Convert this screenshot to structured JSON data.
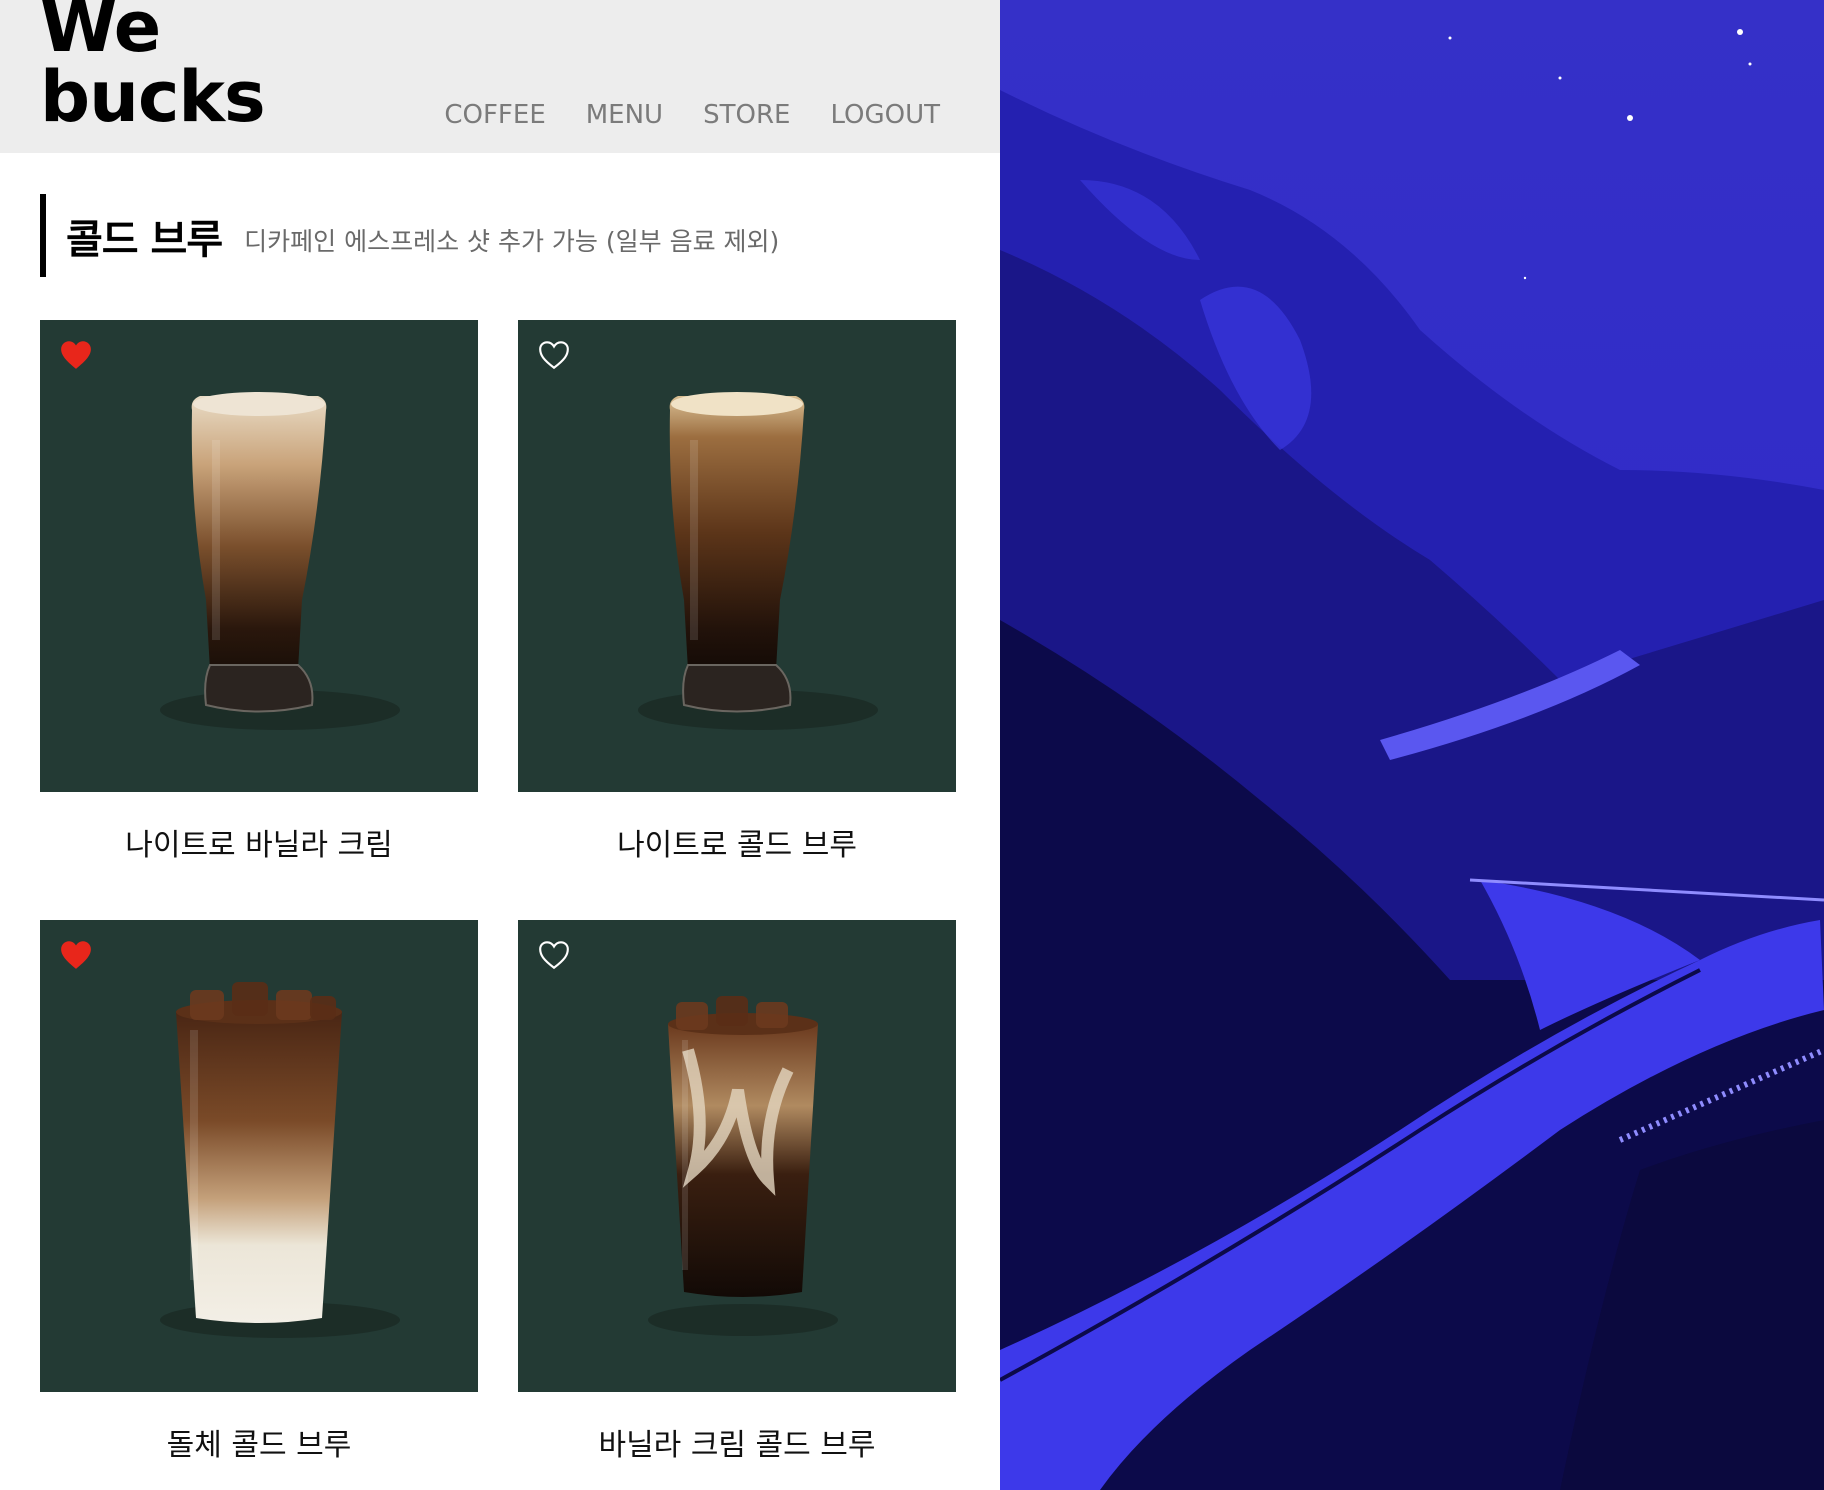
{
  "header": {
    "logo_line1": "We",
    "logo_line2": "bucks",
    "nav": [
      "COFFEE",
      "MENU",
      "STORE",
      "LOGOUT"
    ]
  },
  "section": {
    "title": "콜드 브루",
    "subtitle": "디카페인 에스프레소 샷 추가 가능 (일부 음료 제외)"
  },
  "products": [
    {
      "name": "나이트로 바닐라 크림",
      "liked": true,
      "icon": "heart-filled-icon"
    },
    {
      "name": "나이트로 콜드 브루",
      "liked": false,
      "icon": "heart-outline-icon"
    },
    {
      "name": "돌체 콜드 브루",
      "liked": true,
      "icon": "heart-filled-icon"
    },
    {
      "name": "바닐라 크림 콜드 브루",
      "liked": false,
      "icon": "heart-outline-icon"
    }
  ],
  "colors": {
    "header_bg": "#ededed",
    "card_bg": "#233a34",
    "heart_active": "#e8261b",
    "nav_text": "#7b7b7b",
    "wallpaper": "#2a28c8"
  }
}
